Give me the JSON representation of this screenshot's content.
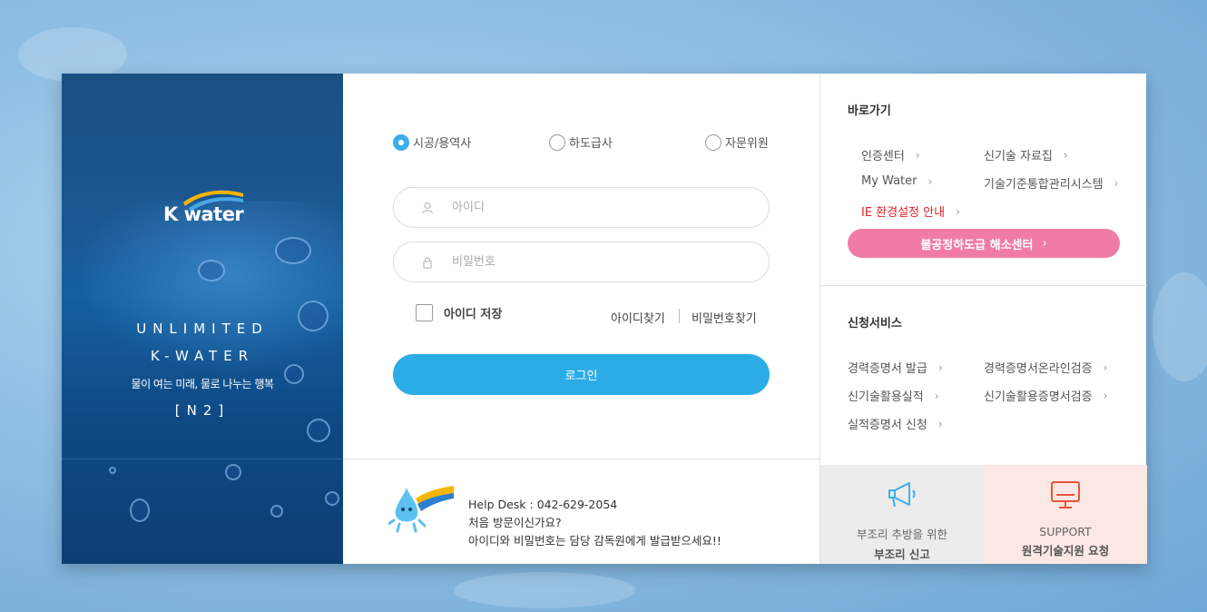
{
  "brand": {
    "logo_text": "K water",
    "slogan_line1": "UNLIMITED",
    "slogan_line2": "K-WATER",
    "slogan_line3": "물이 여는 미래, 물로 나누는 행복",
    "slogan_line4": "[N2]"
  },
  "login": {
    "user_types": [
      {
        "label": "시공/용역사",
        "selected": true
      },
      {
        "label": "하도급사",
        "selected": false
      },
      {
        "label": "자문위원",
        "selected": false
      }
    ],
    "id_placeholder": "아이디",
    "pw_placeholder": "비밀번호",
    "save_id_label": "아이디 저장",
    "find_id_label": "아이디찾기",
    "find_pw_label": "비밀번호찾기",
    "login_label": "로그인"
  },
  "help": {
    "line1": "Help Desk : 042-629-2054",
    "line2": "처음 방문이신가요?",
    "line3": "아이디와 비밀번호는 담당 감독원에게 발급받으세요!!"
  },
  "shortcuts": {
    "title": "바로가기",
    "links": [
      {
        "label": "인증센터"
      },
      {
        "label": "신기술 자료집"
      },
      {
        "label": "My Water"
      },
      {
        "label": "기술기준통합관리시스템"
      },
      {
        "label": "IE 환경설정 안내"
      }
    ],
    "pink_button": "불공정하도급 해소센터"
  },
  "services": {
    "title": "신청서비스",
    "links": [
      {
        "label": "경력증명서 발급"
      },
      {
        "label": "경력증명서온라인검증"
      },
      {
        "label": "신기술활용실적"
      },
      {
        "label": "신기술활용증명서검증"
      },
      {
        "label": "실적증명서 신청"
      }
    ]
  },
  "tiles": {
    "report_line1": "부조리 추방을 위한",
    "report_line2": "부조리 신고",
    "support_line1": "SUPPORT",
    "support_line2": "원격기술지원 요청"
  },
  "colors": {
    "accent_blue": "#2cace6",
    "pink_button": "#f07ca6",
    "link_red": "#e0232a",
    "left_panel": "#1a5792"
  },
  "icons": {
    "user": "user-icon",
    "lock": "lock-icon",
    "megaphone": "megaphone-icon",
    "monitor": "monitor-icon",
    "chevron": "chevron-right-icon"
  }
}
